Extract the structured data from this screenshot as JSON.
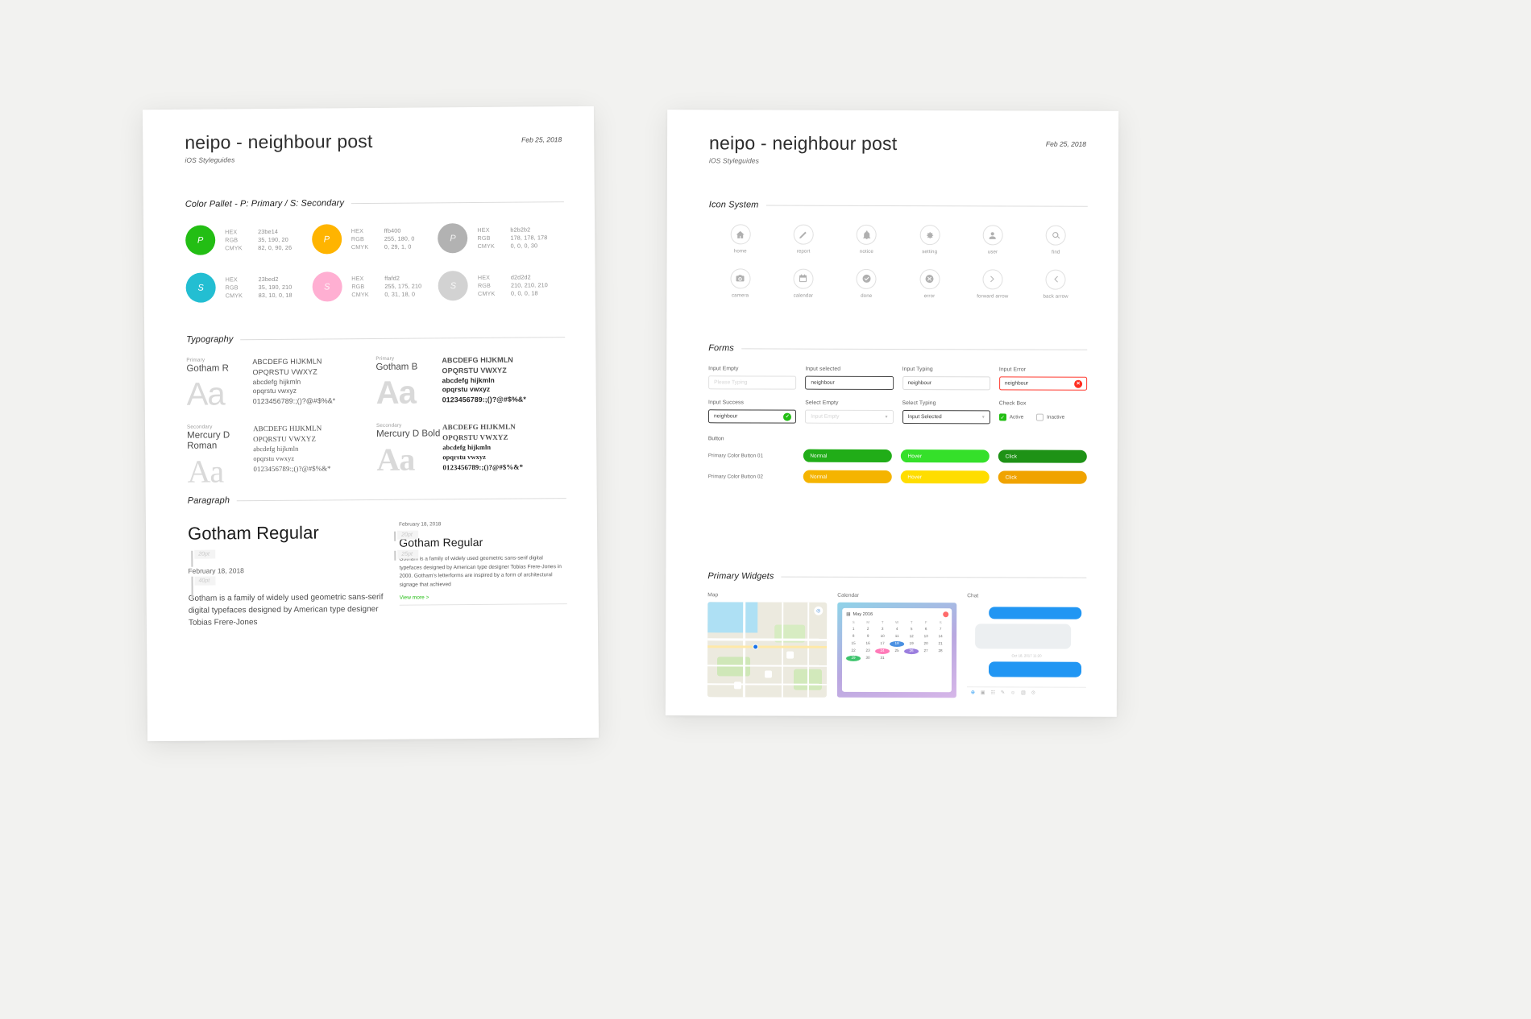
{
  "header": {
    "title": "neipo - neighbour post",
    "subtitle": "iOS Styleguides",
    "date": "Feb 25, 2018"
  },
  "left_page": {
    "sections": {
      "color": "Color Pallet - P: Primary / S: Secondary",
      "typography": "Typography",
      "paragraph": "Paragraph"
    },
    "palette": {
      "keys": {
        "hex": "HEX",
        "rgb": "RGB",
        "cmyk": "CMYK"
      },
      "primary": [
        {
          "letter": "P",
          "swatch": "#23be14",
          "hex": "23be14",
          "rgb": "35, 190, 20",
          "cmyk": "82, 0, 90, 26"
        },
        {
          "letter": "P",
          "swatch": "#ffb400",
          "hex": "ffb400",
          "rgb": "255, 180, 0",
          "cmyk": "0, 29, 1, 0"
        },
        {
          "letter": "P",
          "swatch": "#b2b2b2",
          "hex": "b2b2b2",
          "rgb": "178, 178, 178",
          "cmyk": "0, 0, 0, 30"
        }
      ],
      "secondary": [
        {
          "letter": "S",
          "swatch": "#23bed2",
          "hex": "23bed2",
          "rgb": "35, 190, 210",
          "cmyk": "83, 10, 0, 18"
        },
        {
          "letter": "S",
          "swatch": "#ffafd2",
          "hex": "ffafd2",
          "rgb": "255, 175, 210",
          "cmyk": "0, 31, 18, 0"
        },
        {
          "letter": "S",
          "swatch": "#d2d2d2",
          "hex": "d2d2d2",
          "rgb": "210, 210, 210",
          "cmyk": "0, 0, 0, 18"
        }
      ]
    },
    "typefaces": [
      {
        "kind": "Primary",
        "name": "Gotham R",
        "aa": "Aa",
        "upper1": "ABCDEFG HIJKMLN",
        "upper2": "OPQRSTU VWXYZ",
        "lower1": "abcdefg hijkmln",
        "lower2": "opqrstu vwxyz",
        "numerals": "0123456789:;()?@#$%&*"
      },
      {
        "kind": "Primary",
        "name": "Gotham B",
        "aa": "Aa",
        "upper1": "ABCDEFG HIJKMLN",
        "upper2": "OPQRSTU VWXYZ",
        "lower1": "abcdefg hijkmln",
        "lower2": "opqrstu vwxyz",
        "numerals": "0123456789:;()?@#$%&*"
      },
      {
        "kind": "Secondary",
        "name": "Mercury D Roman",
        "aa": "Aa",
        "upper1": "ABCDEFG HIJKMLN",
        "upper2": "OPQRSTU VWXYZ",
        "lower1": "abcdefg hijkmln",
        "lower2": "opqrstu vwxyz",
        "numerals": "0123456789:;()?@#$%&*"
      },
      {
        "kind": "Secondary",
        "name": "Mercury D Bold",
        "aa": "Aa",
        "upper1": "ABCDEFG HIJKMLN",
        "upper2": "OPQRSTU VWXYZ",
        "lower1": "abcdefg hijkmln",
        "lower2": "opqrstu vwxyz",
        "numerals": "0123456789:;()?@#$%&*"
      }
    ],
    "paragraph": {
      "large": {
        "heading": "Gotham Regular",
        "size_heading": "20pt",
        "date": "February 18, 2018",
        "size_body": "40pt",
        "body": "Gotham is a family of widely used geometric sans-serif digital typefaces designed by American type designer Tobias Frere-Jones"
      },
      "small": {
        "date": "February 18, 2018",
        "size_date": "20pt",
        "heading": "Gotham Regular",
        "size_heading": "25pt",
        "body": "Gotham is a family of widely used geometric sans-serif digital typefaces designed by American type designer Tobias Frere-Jones in 2000. Gotham's letterforms are inspired by a form of architectural signage that achieved",
        "more": "View more >"
      }
    }
  },
  "right_page": {
    "sections": {
      "icons": "Icon System",
      "forms": "Forms",
      "widgets": "Primary Widgets"
    },
    "icons": [
      {
        "name": "home-icon",
        "label": "home"
      },
      {
        "name": "report-icon",
        "label": "report"
      },
      {
        "name": "notice-icon",
        "label": "notice"
      },
      {
        "name": "setting-icon",
        "label": "setting"
      },
      {
        "name": "user-icon",
        "label": "user"
      },
      {
        "name": "find-icon",
        "label": "find"
      },
      {
        "name": "camera-icon",
        "label": "camera"
      },
      {
        "name": "calendar-icon",
        "label": "calendar"
      },
      {
        "name": "done-icon",
        "label": "done"
      },
      {
        "name": "error-icon",
        "label": "error"
      },
      {
        "name": "forward-arrow-icon",
        "label": "forward arrow"
      },
      {
        "name": "back-arrow-icon",
        "label": "back arrow"
      }
    ],
    "forms": {
      "row1": [
        {
          "label": "Input Empty",
          "value": "",
          "placeholder": "Please Typing",
          "state": "empty"
        },
        {
          "label": "Input selected",
          "value": "neighbour",
          "state": "selected"
        },
        {
          "label": "Input Typing",
          "value": "neighbour",
          "state": "typing"
        },
        {
          "label": "Input Error",
          "value": "neighbour",
          "state": "error",
          "badge": "✕"
        }
      ],
      "row2": [
        {
          "label": "Input Success",
          "value": "neighbour",
          "state": "success",
          "badge": "✓"
        },
        {
          "label": "Select Empty",
          "value": "",
          "placeholder": "Input Empty",
          "state": "select-empty"
        },
        {
          "label": "Select Typing",
          "value": "Input Selected",
          "state": "select-typing"
        }
      ],
      "checkbox": {
        "label": "Check Box",
        "active": "Active",
        "inactive": "Inactive",
        "check_glyph": "✓"
      },
      "button_label": "Button",
      "buttons": [
        {
          "label": "Primary Color Button 01",
          "states": [
            {
              "text": "Normal",
              "color": "#21ad18"
            },
            {
              "text": "Hover",
              "color": "#35e02a"
            },
            {
              "text": "Click",
              "color": "#1e9216"
            }
          ]
        },
        {
          "label": "Primary Color Button 02",
          "states": [
            {
              "text": "Normal",
              "color": "#f5b400"
            },
            {
              "text": "Hover",
              "color": "#ffdd00"
            },
            {
              "text": "Click",
              "color": "#f0a300"
            }
          ]
        }
      ]
    },
    "widgets": {
      "map": {
        "label": "Map",
        "locate_icon": "◎",
        "chips": [
          "◻",
          "◻",
          "◻"
        ]
      },
      "calendar": {
        "label": "Calendar",
        "title": "May 2016",
        "weekdays": [
          "S",
          "M",
          "T",
          "W",
          "T",
          "F",
          "S"
        ],
        "days": [
          "1",
          "2",
          "3",
          "4",
          "5",
          "6",
          "7",
          "8",
          "9",
          "10",
          "11",
          "12",
          "13",
          "14",
          "15",
          "16",
          "17",
          "18",
          "19",
          "20",
          "21",
          "22",
          "23",
          "24",
          "25",
          "26",
          "27",
          "28",
          "29",
          "30",
          "31",
          "",
          "",
          "",
          ""
        ],
        "marked": {
          "18": "blue",
          "24": "pink",
          "26": "purple",
          "29": "green"
        }
      },
      "chat": {
        "label": "Chat",
        "timestamp": "Oct 18, 2017 11:20",
        "toolbar": [
          "⊕",
          "▣",
          "☷",
          "✎",
          "☺",
          "▤",
          "⊙"
        ]
      }
    }
  }
}
